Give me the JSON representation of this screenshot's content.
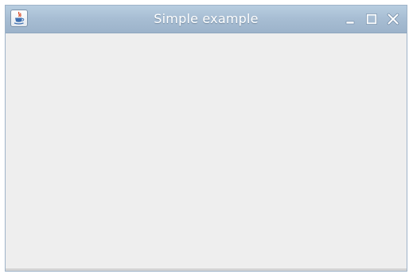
{
  "window": {
    "title": "Simple example",
    "app_icon": "java-cup-icon",
    "controls": [
      {
        "name": "minimize-button",
        "icon": "minimize-icon"
      },
      {
        "name": "maximize-button",
        "icon": "maximize-icon"
      },
      {
        "name": "close-button",
        "icon": "close-icon"
      }
    ]
  },
  "colors": {
    "titlebar": "#a7bdd3",
    "title_text": "#ffffff",
    "content_background": "#eeeeee"
  }
}
